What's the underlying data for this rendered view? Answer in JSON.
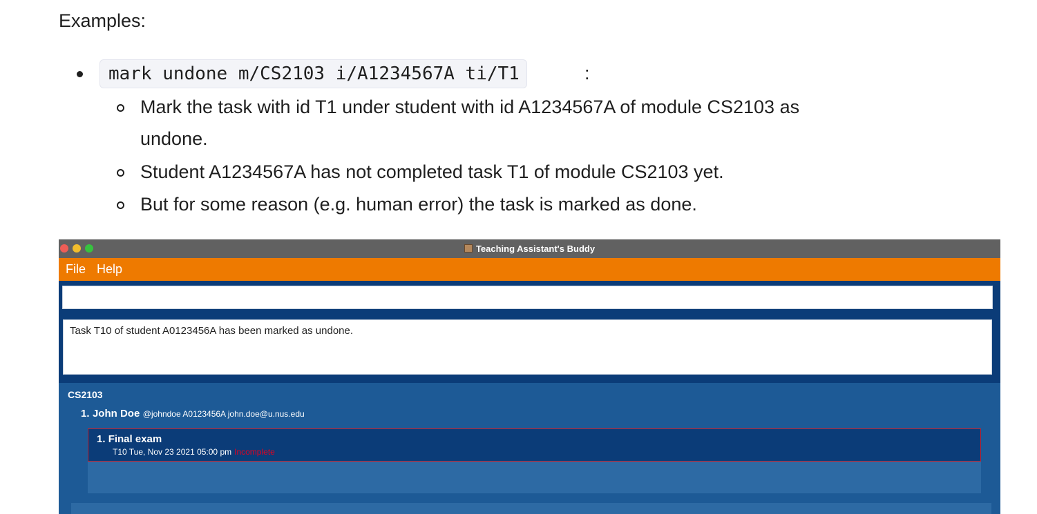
{
  "doc": {
    "heading": "Examples:",
    "code": "mark undone m/CS2103 i/A1234567A ti/T1",
    "colon": ":",
    "bullets": [
      "Mark the task with id T1 under student with id A1234567A of module CS2103 as",
      "undone.",
      "Student A1234567A has not completed task T1 of module CS2103 yet.",
      "But for some reason (e.g. human error) the task is marked as done."
    ]
  },
  "app": {
    "window_title": "Teaching Assistant's Buddy",
    "menu": {
      "file": "File",
      "help": "Help"
    },
    "command_input": {
      "value": "",
      "placeholder": ""
    },
    "result": "Task T10 of student A0123456A has been marked as undone.",
    "module": {
      "code": "CS2103",
      "student": {
        "index": "1.",
        "name": "John Doe",
        "details": "@johndoe A0123456A john.doe@u.nus.edu"
      },
      "task": {
        "index": "1.",
        "title": "Final exam",
        "meta": "T10 Tue, Nov 23 2021 05:00 pm",
        "status": "Incomplete"
      }
    }
  },
  "colors": {
    "menubar": "#ee7a00",
    "titlebar": "#616161",
    "command_area": "#0b3c78",
    "list_background": "#1d5a96",
    "task_border": "#c4222e",
    "status_incomplete": "#e6001f"
  }
}
